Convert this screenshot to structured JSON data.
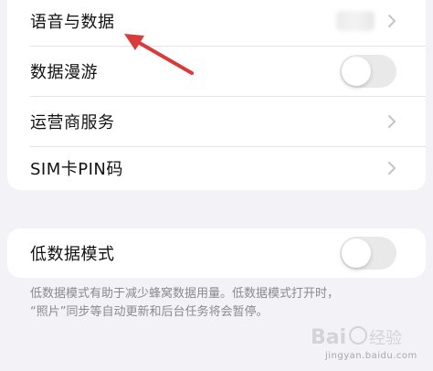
{
  "cellular_settings": {
    "rows": [
      {
        "label": "语音与数据",
        "control": "value",
        "value_blurred": true
      },
      {
        "label": "数据漫游",
        "control": "toggle",
        "state": "off"
      },
      {
        "label": "运营商服务",
        "control": "chevron"
      },
      {
        "label": "SIM卡PIN码",
        "control": "chevron"
      }
    ]
  },
  "low_data_mode": {
    "label": "低数据模式",
    "state": "off",
    "footnote_line1": "低数据模式有助于减少蜂窝数据用量。低数据模式打开时，",
    "footnote_line2": "“照片”同步等自动更新和后台任务将会暂停。"
  },
  "watermark": {
    "text": "jingyan.baidu.com"
  },
  "colors": {
    "background": "#f2f2f7",
    "group": "#ffffff",
    "toggle_off": "#e9e9ea",
    "chevron": "#c4c4c7",
    "annotation_arrow": "#d93a3a",
    "footnote": "#8a8a8e"
  },
  "icons": {
    "chevron": "chevron-right-icon",
    "annotation": "red-arrow-icon"
  }
}
